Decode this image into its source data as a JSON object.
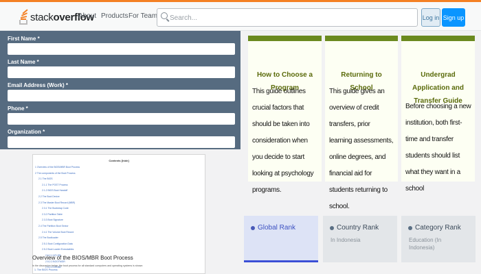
{
  "header": {
    "logo_plain": "stack",
    "logo_bold": "overflow",
    "nav": [
      "About",
      "Products",
      "For Teams"
    ],
    "search_placeholder": "Search...",
    "login_label": "Log in",
    "signup_label": "Sign up"
  },
  "form": {
    "fields": [
      "First Name *",
      "Last Name *",
      "Email Address (Work) *",
      "Phone *",
      "Organization *"
    ]
  },
  "document": {
    "contents_title": "Contents [hide]",
    "toc": [
      "1 Overview of the BIOS/MBR Boot Process",
      "2 The components of the Boot Process",
      "2.1 The BIOS",
      "2.1.1 The POST Process",
      "2.1.2 BIOS Boot Handoff",
      "2.2 The Boot Device",
      "2.3 The Master Boot Record (MBR)",
      "2.3.1 The Bootstrap Code",
      "2.3.2 Partition Table",
      "2.3.3 Boot Signature",
      "2.4 The Partition Boot Sector",
      "2.4.1 The Volume Boot Record",
      "2.5 The Bootloader",
      "2.5.1 Boot Configuration Data",
      "2.5.2 Boot Loader Executables",
      "2.5.2.1 NTLDR",
      "2.5.2.2 BOOTMGR",
      "2.5.2.3 GRUB2"
    ],
    "caption": "Overview of the BIOS/MBR Boot Process",
    "subtext": "In the discussion below, the boot process for all standard computers and operating systems is shown:",
    "subtext2": "1. The BIOS Process"
  },
  "cards": [
    {
      "title": "How to Choose a Program",
      "body": "This guide outlines crucial factors that should be taken into consideration when you decide to start looking at psychology programs."
    },
    {
      "title": "Returning to School",
      "body": "This guide gives an overview of credit transfers, prior learning assessments, online degrees, and financial aid for students returning to school."
    },
    {
      "title": "Undergrad Application and Transfer Guide",
      "body": "Before choosing a new institution, both first-time and transfer students should list what they want in a school"
    }
  ],
  "ranks": [
    {
      "title": "Global Rank",
      "sub": "",
      "active": true
    },
    {
      "title": "Country Rank",
      "sub": "In Indonesia",
      "active": false
    },
    {
      "title": "Category Rank",
      "sub": "Education (In Indonesia)",
      "active": false
    }
  ],
  "colors": {
    "accent": "#f48024",
    "signup": "#0a95ff",
    "form_bg": "#566b80",
    "card_bar": "#6b8a1f",
    "rank_active": "#3b4fd6"
  }
}
